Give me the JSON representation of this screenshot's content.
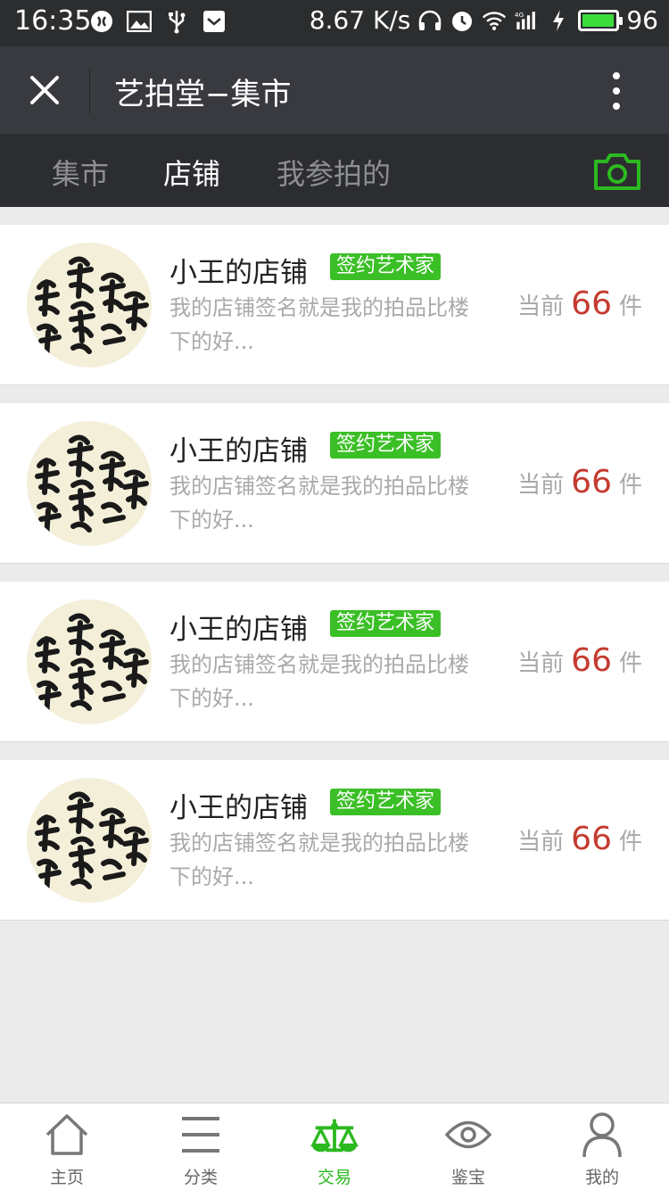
{
  "status_bar": {
    "time": "16:35",
    "network_speed": "8.67 K/s",
    "signal": "4G",
    "battery_percent": 96,
    "battery_text": "96"
  },
  "header": {
    "title": "艺拍堂−集市",
    "close_icon": "close-icon",
    "more_icon": "more-vertical-icon"
  },
  "tabs": [
    {
      "label": "集市",
      "active": false
    },
    {
      "label": "店铺",
      "active": true
    },
    {
      "label": "我参拍的",
      "active": false
    }
  ],
  "camera_icon": "camera-icon",
  "shops": [
    {
      "name": "小王的店铺",
      "badge": "签约艺术家",
      "desc": "我的店铺签名就是我的拍品比楼下的好...",
      "count_prefix": "当前",
      "count": "66",
      "count_suffix": "件"
    },
    {
      "name": "小王的店铺",
      "badge": "签约艺术家",
      "desc": "我的店铺签名就是我的拍品比楼下的好...",
      "count_prefix": "当前",
      "count": "66",
      "count_suffix": "件"
    },
    {
      "name": "小王的店铺",
      "badge": "签约艺术家",
      "desc": "我的店铺签名就是我的拍品比楼下的好...",
      "count_prefix": "当前",
      "count": "66",
      "count_suffix": "件"
    },
    {
      "name": "小王的店铺",
      "badge": "签约艺术家",
      "desc": "我的店铺签名就是我的拍品比楼下的好...",
      "count_prefix": "当前",
      "count": "66",
      "count_suffix": "件"
    }
  ],
  "bottom_nav": [
    {
      "label": "主页",
      "icon": "home-icon",
      "active": false
    },
    {
      "label": "分类",
      "icon": "menu-icon",
      "active": false
    },
    {
      "label": "交易",
      "icon": "scale-icon",
      "active": true
    },
    {
      "label": "鉴宝",
      "icon": "eye-icon",
      "active": false
    },
    {
      "label": "我的",
      "icon": "user-icon",
      "active": false
    }
  ],
  "colors": {
    "accent_green": "#2cb920",
    "badge_green": "#3bbf26",
    "count_red": "#c53a2f",
    "header_bg": "#393a3f",
    "tab_bg": "#2c2d31"
  }
}
